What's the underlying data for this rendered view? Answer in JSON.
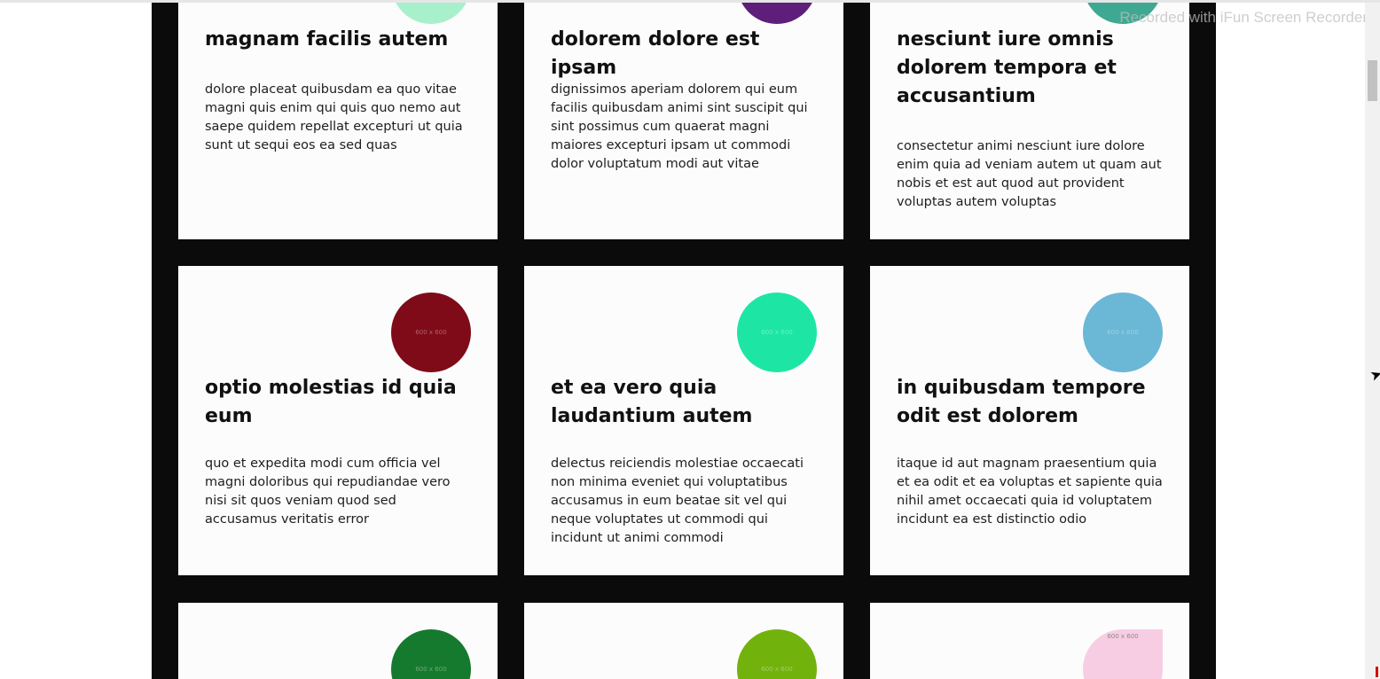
{
  "watermark": "Recorded with iFun Screen Recorder",
  "cards": [
    {
      "title": "magnam facilis autem",
      "body": "dolore placeat quibusdam ea quo vitae magni quis enim qui quis quo nemo aut saepe quidem repellat excepturi ut quia sunt ut sequi eos ea sed quas",
      "color": "#a8efcc",
      "thumb_label": ""
    },
    {
      "title": "dolorem dolore est ipsam",
      "body": "dignissimos aperiam dolorem qui eum facilis quibusdam animi sint suscipit qui sint possimus cum quaerat magni maiores excepturi ipsam ut commodi dolor voluptatum modi aut vitae",
      "color": "#5e1f7a",
      "thumb_label": ""
    },
    {
      "title": "nesciunt iure omnis dolorem tempora et accusantium",
      "body": "consectetur animi nesciunt iure dolore enim quia ad veniam autem ut quam aut nobis et est aut quod aut provident voluptas autem voluptas",
      "color": "#3fa893",
      "thumb_label": ""
    },
    {
      "title": "optio molestias id quia eum",
      "body": "quo et expedita modi cum officia vel magni doloribus qui repudiandae vero nisi sit quos veniam quod sed accusamus veritatis error",
      "color": "#7f0b18",
      "thumb_label": "600 x 600"
    },
    {
      "title": "et ea vero quia laudantium autem",
      "body": "delectus reiciendis molestiae occaecati non minima eveniet qui voluptatibus accusamus in eum beatae sit vel qui neque voluptates ut commodi qui incidunt ut animi commodi",
      "color": "#1de6a5",
      "thumb_label": "600 x 600"
    },
    {
      "title": "in quibusdam tempore odit est dolorem",
      "body": "itaque id aut magnam praesentium quia et ea odit et ea voluptas et sapiente quia nihil amet occaecati quia id voluptatem incidunt ea est distinctio odio",
      "color": "#6bb7d6",
      "thumb_label": "600 x 600"
    },
    {
      "title": "",
      "body": "",
      "color": "#157a2d",
      "thumb_label": "600 x 600"
    },
    {
      "title": "",
      "body": "",
      "color": "#72b20d",
      "thumb_label": "600 x 600"
    },
    {
      "title": "",
      "body": "",
      "color": "#f7cde3",
      "thumb_label": "600 x 600"
    }
  ]
}
